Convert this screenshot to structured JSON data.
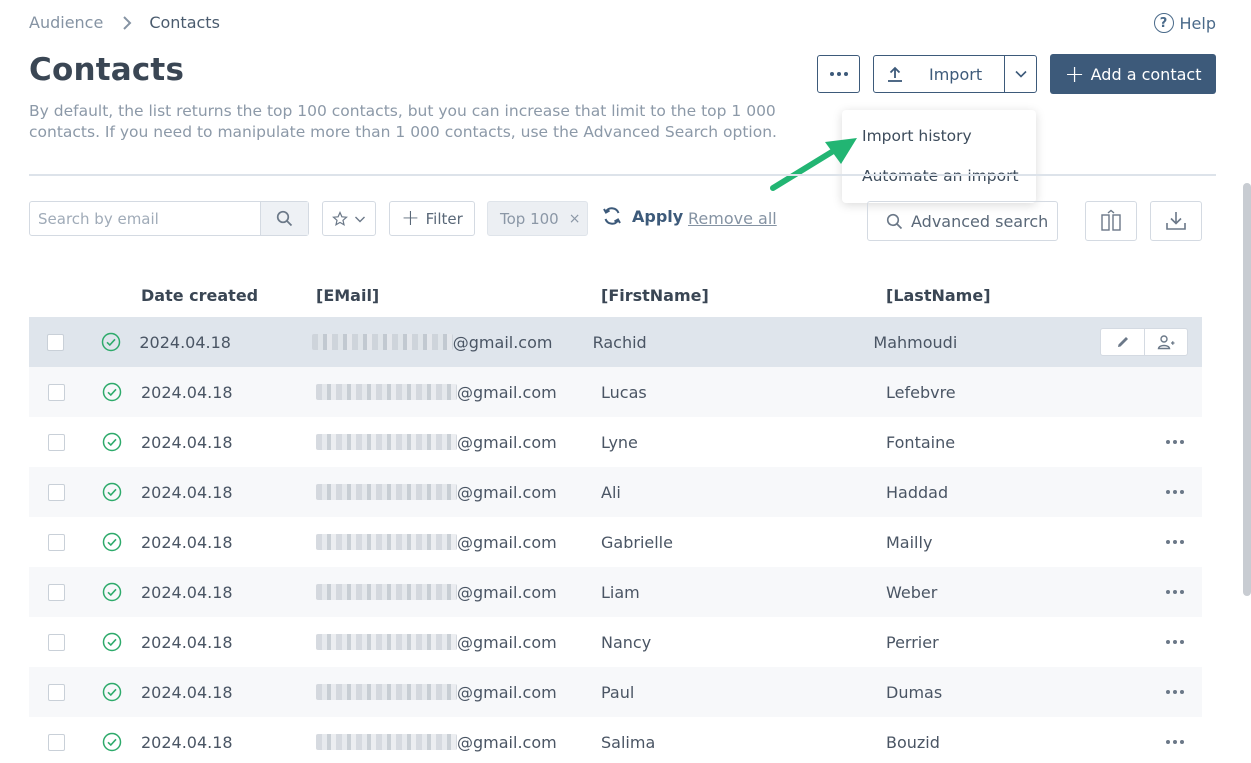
{
  "breadcrumb": {
    "parent": "Audience",
    "current": "Contacts"
  },
  "help_label": "Help",
  "page_title": "Contacts",
  "description": "By default, the list returns the top 100 contacts, but you can increase that limit to the top 1 000 contacts. If you need to manipulate more than 1 000 contacts, use the Advanced Search option.",
  "toolbar": {
    "import_label": "Import",
    "add_contact_label": "Add a contact"
  },
  "import_menu": [
    {
      "label": "Import history"
    },
    {
      "label": "Automate an import"
    }
  ],
  "filters": {
    "search_placeholder": "Search by email",
    "filter_label": "Filter",
    "chip_label": "Top 100",
    "chip_remove": "×",
    "apply_label": "Apply",
    "remove_all_label": "Remove all",
    "advanced_search_label": "Advanced search"
  },
  "table": {
    "headers": {
      "date": "Date created",
      "email": "[EMail]",
      "first": "[FirstName]",
      "last": "[LastName]"
    },
    "rows": [
      {
        "date": "2024.04.18",
        "email_domain": "@gmail.com",
        "first": "Rachid",
        "last": "Mahmoudi"
      },
      {
        "date": "2024.04.18",
        "email_domain": "@gmail.com",
        "first": "Lucas",
        "last": "Lefebvre"
      },
      {
        "date": "2024.04.18",
        "email_domain": "@gmail.com",
        "first": "Lyne",
        "last": "Fontaine"
      },
      {
        "date": "2024.04.18",
        "email_domain": "@gmail.com",
        "first": "Ali",
        "last": "Haddad"
      },
      {
        "date": "2024.04.18",
        "email_domain": "@gmail.com",
        "first": "Gabrielle",
        "last": "Mailly"
      },
      {
        "date": "2024.04.18",
        "email_domain": "@gmail.com",
        "first": "Liam",
        "last": "Weber"
      },
      {
        "date": "2024.04.18",
        "email_domain": "@gmail.com",
        "first": "Nancy",
        "last": "Perrier"
      },
      {
        "date": "2024.04.18",
        "email_domain": "@gmail.com",
        "first": "Paul",
        "last": "Dumas"
      },
      {
        "date": "2024.04.18",
        "email_domain": "@gmail.com",
        "first": "Salima",
        "last": "Bouzid"
      }
    ]
  },
  "colors": {
    "primary": "#3d5a7a",
    "status_ok": "#2eaa6b",
    "arrow": "#22b573",
    "selected_row": "#dfe5ec"
  },
  "icons": [
    "chevron-right-icon",
    "help-icon",
    "more-icon",
    "upload-icon",
    "chevron-down-icon",
    "plus-icon",
    "search-icon",
    "star-icon",
    "close-icon",
    "refresh-icon",
    "columns-icon",
    "download-icon",
    "check-circle-icon",
    "pencil-icon",
    "user-add-icon"
  ]
}
